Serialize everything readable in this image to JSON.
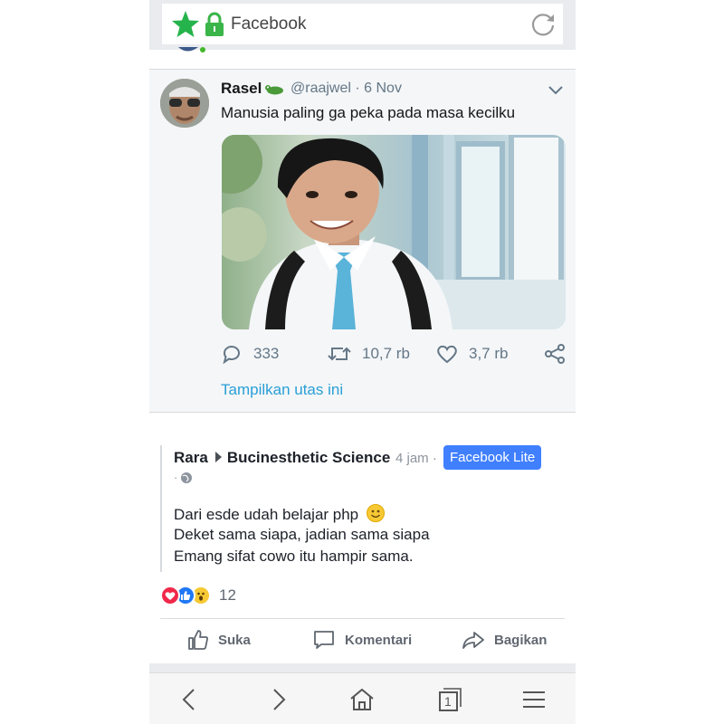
{
  "browser": {
    "url_label": "Facebook"
  },
  "tweet": {
    "name": "Rasel",
    "handle_date": "@raajwel · 6 Nov",
    "text": "Manusia paling ga peka pada masa kecilku",
    "replies": "333",
    "retweets": "10,7 rb",
    "likes": "3,7 rb",
    "thread_link": "Tampilkan utas ini"
  },
  "post": {
    "author": "Rara",
    "group": "Bucinesthetic Science",
    "time": "4 jam ·",
    "badge": "Facebook Lite",
    "globe_prefix": "·",
    "lines": [
      "Dari esde udah belajar php",
      "Deket sama siapa, jadian sama siapa",
      "Emang sifat cowo itu hampir sama."
    ],
    "reaction_count": "12",
    "actions": {
      "like": "Suka",
      "comment": "Komentari",
      "share": "Bagikan"
    }
  },
  "colors": {
    "accent_blue": "#4080ff",
    "link_blue": "#2a9fd6",
    "star_green": "#25b34b",
    "lock_green": "#3ab54a",
    "love_red": "#f0284a"
  },
  "icons": {
    "nav": [
      "back-icon",
      "forward-icon",
      "home-icon",
      "tabs-icon",
      "menu-icon"
    ],
    "tabs_count": "1"
  }
}
